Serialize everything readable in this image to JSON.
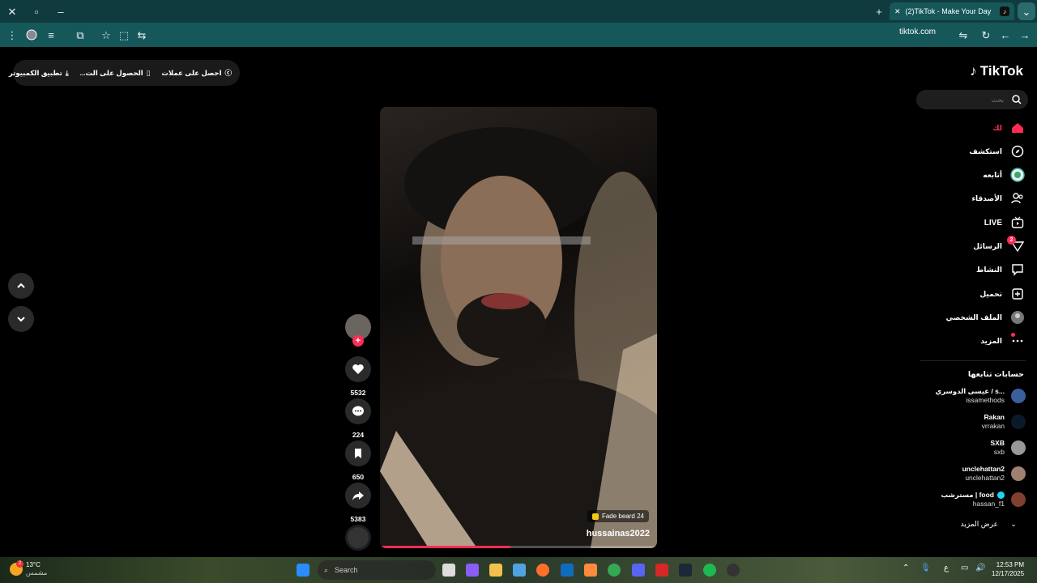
{
  "browser": {
    "tab_title": "(2)TikTok - Make Your Day",
    "url": "tiktok.com",
    "new_tab_symbol": "+"
  },
  "topbar": {
    "coins": "احصل على عملات",
    "get_app": "الحصول على الت...",
    "desktop_app": "تطبيق الكمبيوتر"
  },
  "logo": "TikTok",
  "search": {
    "placeholder": "بحث"
  },
  "nav": [
    {
      "label": "لك",
      "icon": "home-icon",
      "color": "#fe2c55"
    },
    {
      "label": "استكشف",
      "icon": "compass-icon"
    },
    {
      "label": "أتابعه",
      "icon": "following-avatar-icon"
    },
    {
      "label": "الأصدقاء",
      "icon": "friends-icon"
    },
    {
      "label": "LIVE",
      "icon": "live-icon"
    },
    {
      "label": "الرسائل",
      "icon": "messages-icon",
      "badge": "2"
    },
    {
      "label": "النشاط",
      "icon": "activity-icon"
    },
    {
      "label": "تحميل",
      "icon": "upload-icon"
    },
    {
      "label": "الملف الشخصي",
      "icon": "profile-avatar-icon"
    },
    {
      "label": "المزيد",
      "icon": "more-icon"
    }
  ],
  "following": {
    "heading": "حسابات تتابعها",
    "accounts": [
      {
        "name": "عيسى الدوسري / s...",
        "handle": "issamethods"
      },
      {
        "name": "Rakan",
        "handle": "vrrakan"
      },
      {
        "name": "SXB",
        "handle": "sxb"
      },
      {
        "name": "unclehattan2",
        "handle": "unclehattan2"
      },
      {
        "name": "مسترشب | food",
        "handle": "hassan_f1",
        "verified": true
      }
    ],
    "see_more": "عرض المزيد"
  },
  "video": {
    "tag": "Fade beard 24",
    "username": "hussainas2022",
    "progress": 0.47
  },
  "actions": {
    "likes": "5532",
    "comments": "224",
    "saves": "650",
    "shares": "5383"
  },
  "taskbar": {
    "weather_temp": "13°C",
    "weather_desc": "مشمس",
    "weather_badge": "2",
    "search_label": "Search",
    "time": "12:53 PM",
    "date": "12/17/2025",
    "lang": "ع"
  }
}
